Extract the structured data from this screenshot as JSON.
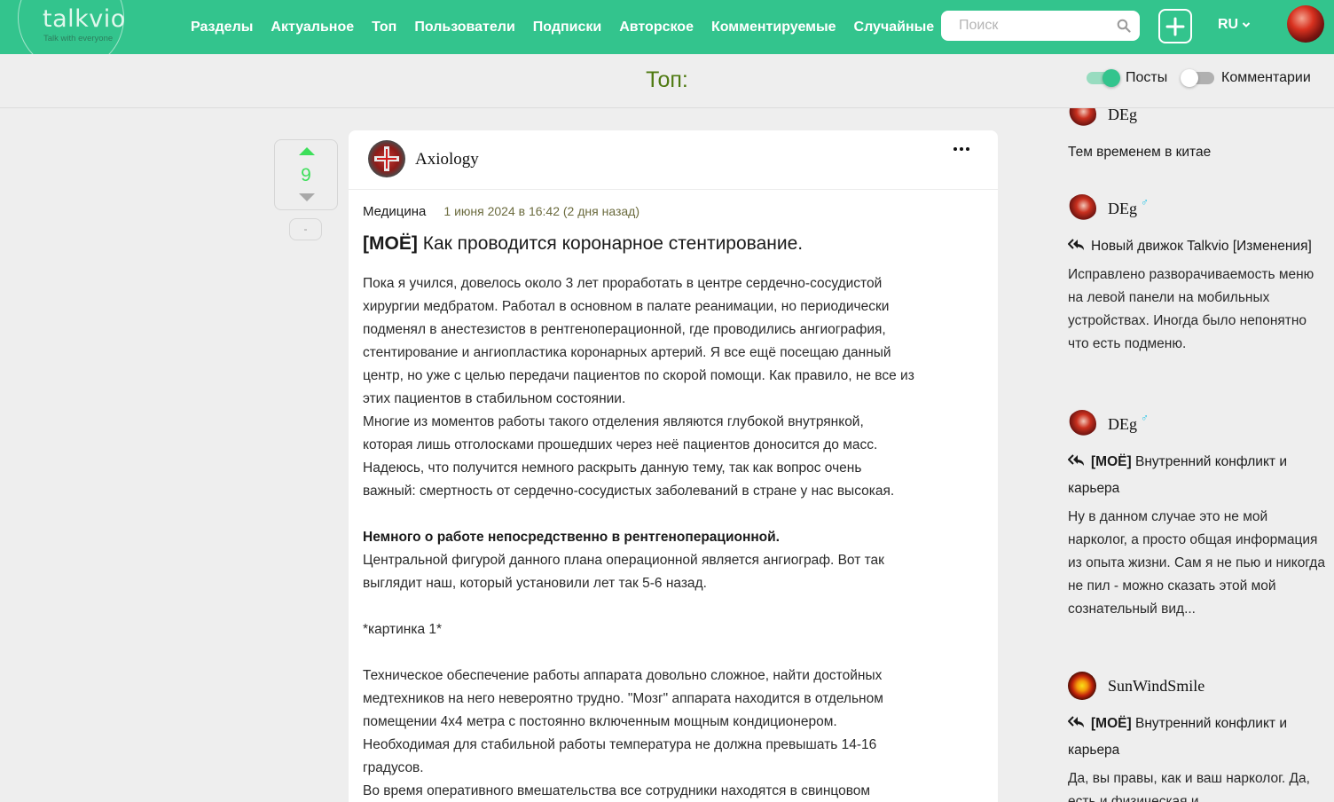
{
  "header": {
    "logo": "talkvio",
    "tagline": "Talk with everyone",
    "nav": [
      "Разделы",
      "Актуальное",
      "Топ",
      "Пользователи",
      "Подписки",
      "Авторское",
      "Комментируемые",
      "Случайные"
    ],
    "search_placeholder": "Поиск",
    "lang": "RU"
  },
  "subheader": {
    "title": "Топ:",
    "toggles": [
      {
        "label": "Посты",
        "on": true
      },
      {
        "label": "Комментарии",
        "on": false
      }
    ]
  },
  "vote": {
    "count": "9",
    "extra": "-"
  },
  "post": {
    "author": "Axiology",
    "section": "Медицина",
    "date": "1 июня 2024 в 16:42 (2 дня назад)",
    "title_tag": "[МОЁ]",
    "title": "Как проводится коронарное стентирование.",
    "body": [
      "Пока я учился, довелось около 3 лет проработать в центре сердечно-сосудистой",
      "хирургии медбратом. Работал в основном в палате реанимации, но периодически",
      "подменял в анестезистов в рентгеноперационной, где проводились ангиография,",
      "стентирование и ангиопластика коронарных артерий. Я все ещё посещаю данный",
      "центр, но уже с целью передачи пациентов по скорой помощи. Как правило, не все из",
      "этих пациентов в стабильном состоянии.",
      "Многие из моментов работы такого отделения являются глубокой внутрянкой,",
      "которая лишь отголосками прошедших через неё пациентов доносится до масс.",
      "Надеюсь, что получится немного раскрыть данную тему, так как вопрос очень",
      "важный: смертность от сердечно-сосудистых заболеваний в стране у нас высокая.",
      "",
      "Немного о работе непосредственно в рентгеноперационной.",
      "Центральной фигурой данного плана операционной является ангиограф. Вот так",
      "выглядит наш, который установили лет так 5-6 назад.",
      "",
      "*картинка 1*",
      "",
      "Техническое обеспечение работы аппарата довольно сложное, найти достойных",
      "медтехников на него невероятно трудно. \"Мозг\" аппарата находится в отдельном",
      "помещении 4х4 метра с постоянно включенным мощным кондиционером.",
      "Необходимая для стабильной работы температура не должна превышать 14-16",
      "градусов.",
      "Во время оперативного вмешательства все сотрудники находятся в свинцовом"
    ]
  },
  "sidebar": {
    "comments": [
      {
        "user": "DEg",
        "gender": "",
        "post_tag": "",
        "post": "Тем временем в китае",
        "text": "",
        "reply": false
      },
      {
        "user": "DEg",
        "gender": "♂",
        "post_tag": "",
        "post": "Новый движок Talkvio [Изменения]",
        "text": "Исправлено разворачиваемость меню на левой панели на мобильных устройствах. Иногда было непонятно что есть подменю.",
        "reply": true
      },
      {
        "user": "DEg",
        "gender": "♂",
        "post_tag": "[МОЁ]",
        "post": "Внутренний конфликт и карьера",
        "text": "Ну в данном случае это не мой нарколог, а просто общая информация из опыта жизни. Сам я не пью и никогда не пил - можно сказать этой мой сознательный вид...",
        "reply": true
      },
      {
        "user": "SunWindSmile",
        "gender": "",
        "post_tag": "[МОЁ]",
        "post": "Внутренний конфликт и карьера",
        "text": "Да, вы правы, как и ваш нарколог. Да, есть и физическая и",
        "reply": true
      }
    ]
  },
  "colors": {
    "brand": "#33c48d",
    "vote_up": "#3ddf5a",
    "title": "#4f7a12",
    "date": "#6b6b3e",
    "gender": "#22c3e6"
  }
}
